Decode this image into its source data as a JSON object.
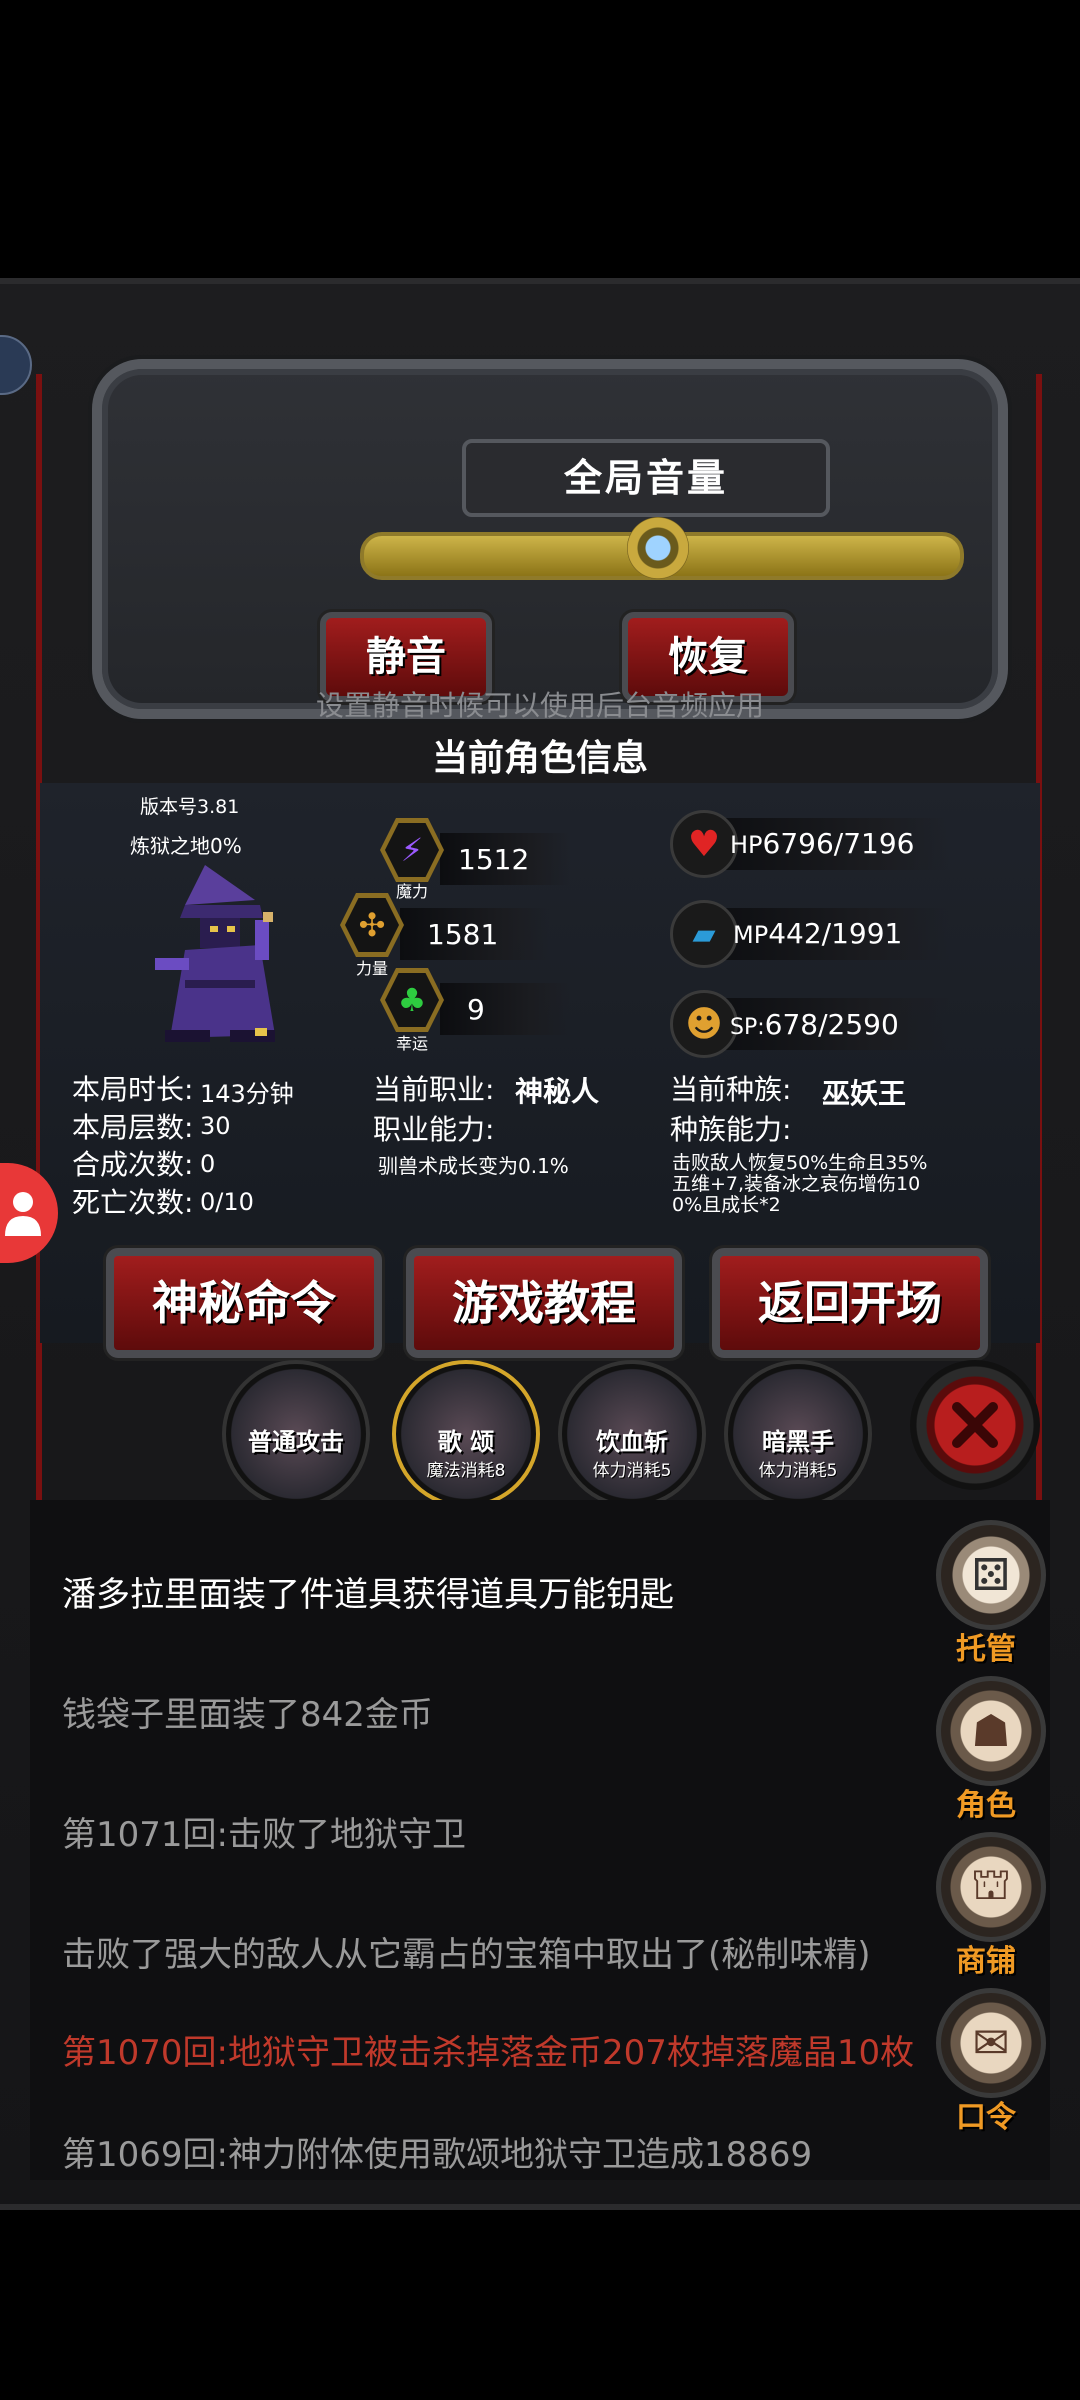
{
  "volume": {
    "title": "全局音量",
    "mute_label": "静音",
    "restore_label": "恢复",
    "hint": "设置静音时候可以使用后台音频应用",
    "level": 0.5
  },
  "character": {
    "title": "当前角色信息",
    "version": "版本号3.81",
    "location": "炼狱之地0%",
    "magic": {
      "value": "1512",
      "caption": "魔力"
    },
    "strength": {
      "value": "1581",
      "caption": "力量"
    },
    "luck": {
      "value": "9",
      "caption": "幸运"
    },
    "hp": {
      "label": "HP",
      "value": "6796/7196"
    },
    "mp": {
      "label": "MP",
      "value": "442/1991"
    },
    "sp": {
      "label": "SP:",
      "value": "678/2590"
    },
    "session_time_label": "本局时长:",
    "session_time": "143分钟",
    "floors_label": "本局层数:",
    "floors": "30",
    "synth_label": "合成次数:",
    "synth": "0",
    "deaths_label": "死亡次数:",
    "deaths": "0/10",
    "job_label": "当前职业:",
    "job": "神秘人",
    "job_ability_label": "职业能力:",
    "job_ability": "驯兽术成长变为0.1%",
    "race_label": "当前种族:",
    "race": "巫妖王",
    "race_ability_label": "种族能力:",
    "race_ability": "击败敌人恢复50%生命且35%五维+7,装备冰之哀伤增伤100%且成长*2"
  },
  "actions": {
    "mystic_label": "神秘命令",
    "tutorial_label": "游戏教程",
    "return_label": "返回开场"
  },
  "skills": [
    {
      "name": "普通攻击",
      "cost": ""
    },
    {
      "name": "歌 颂",
      "cost": "魔法消耗8"
    },
    {
      "name": "饮血斩",
      "cost": "体力消耗5"
    },
    {
      "name": "暗黑手",
      "cost": "体力消耗5"
    }
  ],
  "log": [
    "潘多拉里面装了件道具获得道具万能钥匙",
    "钱袋子里面装了842金币",
    "第1071回:击败了地狱守卫",
    "击败了强大的敌人从它霸占的宝箱中取出了(秘制味精)",
    "第1070回:地狱守卫被击杀掉落金币207枚掉落魔晶10枚",
    "第1069回:神力附体使用歌颂地狱守卫造成18869"
  ],
  "side_menu": {
    "auto_label": "托管",
    "role_label": "角色",
    "shop_label": "商铺",
    "code_label": "口令"
  },
  "colors": {
    "log_highlight": "#c0392b",
    "side_label": "#f09a24"
  }
}
